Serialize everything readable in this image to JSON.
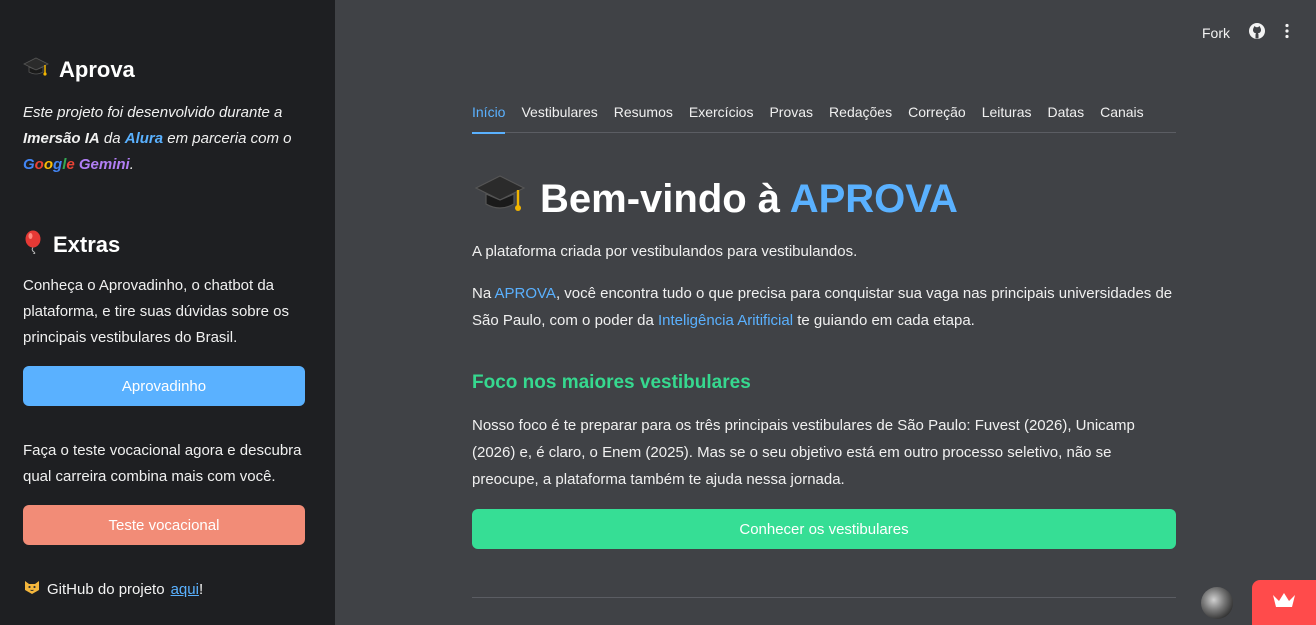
{
  "sidebar": {
    "title": "Aprova",
    "intro": {
      "t1": "Este projeto foi desenvolvido durante a",
      "bold": "Imersão IA",
      "t2": "da",
      "alura": "Alura",
      "t3": "em parceria com o",
      "google": [
        "G",
        "o",
        "o",
        "g",
        "l",
        "e"
      ],
      "gemini": "Gemini",
      "end": "."
    },
    "extras_title": "Extras",
    "extras_text": "Conheça o Aprovadinho, o chatbot da plataforma, e tire suas dúvidas sobre os principais vestibulares do Brasil.",
    "aprovadinho_button": "Aprovadinho",
    "vocacional_text": "Faça o teste vocacional agora e descubra qual carreira combina mais com você.",
    "vocacional_button": "Teste vocacional",
    "github_text": "GitHub do projeto",
    "github_link": "aqui",
    "github_end": "!"
  },
  "topbar": {
    "fork_label": "Fork"
  },
  "tabs": [
    "Início",
    "Vestibulares",
    "Resumos",
    "Exercícios",
    "Provas",
    "Redações",
    "Correção",
    "Leituras",
    "Datas",
    "Canais"
  ],
  "main": {
    "title_prefix": "Bem-vindo à",
    "title_accent": "APROVA",
    "p1": "A plataforma criada por vestibulandos para vestibulandos.",
    "p2_a": "Na",
    "p2_link1": "APROVA",
    "p2_b": ", você encontra tudo o que precisa para conquistar sua vaga nas principais universidades de São Paulo, com o poder da",
    "p2_link2": "Inteligência Aritificial",
    "p2_c": "te guiando em cada etapa.",
    "subhead": "Foco nos maiores vestibulares",
    "p3": "Nosso foco é te preparar para os três principais vestibulares de São Paulo: Fuvest (2026), Unicamp (2026) e, é claro, o Enem (2025). Mas se o seu objetivo está em outro processo seletivo, não se preocupe, a plataforma também te ajuda nessa jornada.",
    "cta_button": "Conhecer os vestibulares"
  },
  "colors": {
    "accent": "#5ab1ff",
    "green": "#36de95",
    "salmon": "#f28c77",
    "badge": "#ff4b4b"
  }
}
